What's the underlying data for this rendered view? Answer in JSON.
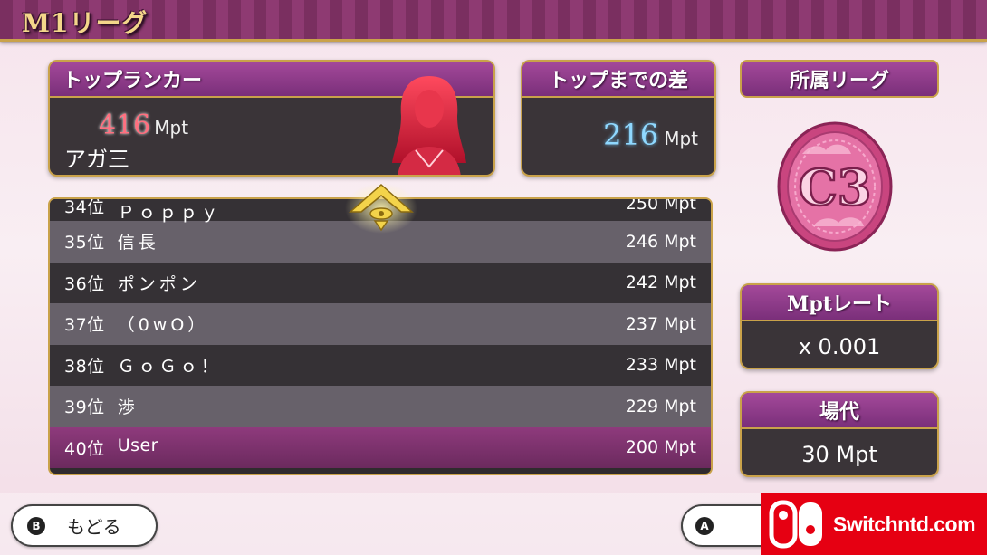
{
  "header": {
    "title": "M1リーグ"
  },
  "top_ranker": {
    "heading": "トップランカー",
    "score": "416",
    "unit": "Mpt",
    "name": "アガ三"
  },
  "gap": {
    "heading": "トップまでの差",
    "value": "216",
    "unit": "Mpt"
  },
  "league": {
    "heading": "所属リーグ",
    "medal_label": "C3"
  },
  "ranking": [
    {
      "rank": "34位",
      "name": "Ｐｏｐｐｙ",
      "points": "250 Mpt"
    },
    {
      "rank": "35位",
      "name": "信長",
      "points": "246 Mpt"
    },
    {
      "rank": "36位",
      "name": "ポンポン",
      "points": "242 Mpt"
    },
    {
      "rank": "37位",
      "name": "（0wO）",
      "points": "237 Mpt"
    },
    {
      "rank": "38位",
      "name": "ＧｏＧｏ！",
      "points": "233 Mpt"
    },
    {
      "rank": "39位",
      "name": "渉",
      "points": "229 Mpt"
    },
    {
      "rank": "40位",
      "name": "User",
      "points": "200 Mpt"
    }
  ],
  "rate": {
    "heading": "Mptレート",
    "value": "x 0.001"
  },
  "bashi": {
    "heading": "場代",
    "value": "30 Mpt"
  },
  "buttons": {
    "back_glyph": "B",
    "back_label": "もどる",
    "a_glyph": "A"
  },
  "watermark": {
    "text": "Switchntd.com"
  },
  "colors": {
    "accent_gold": "#c9a24a",
    "header_purple": "#7a2f60",
    "highlight_row": "#8e3a7c",
    "score_red": "#ff6f7f",
    "gap_blue": "#8fd8ff"
  },
  "icons": {
    "crest": "rank-crest-icon",
    "medal": "league-medal-icon",
    "avatar": "player-silhouette"
  }
}
